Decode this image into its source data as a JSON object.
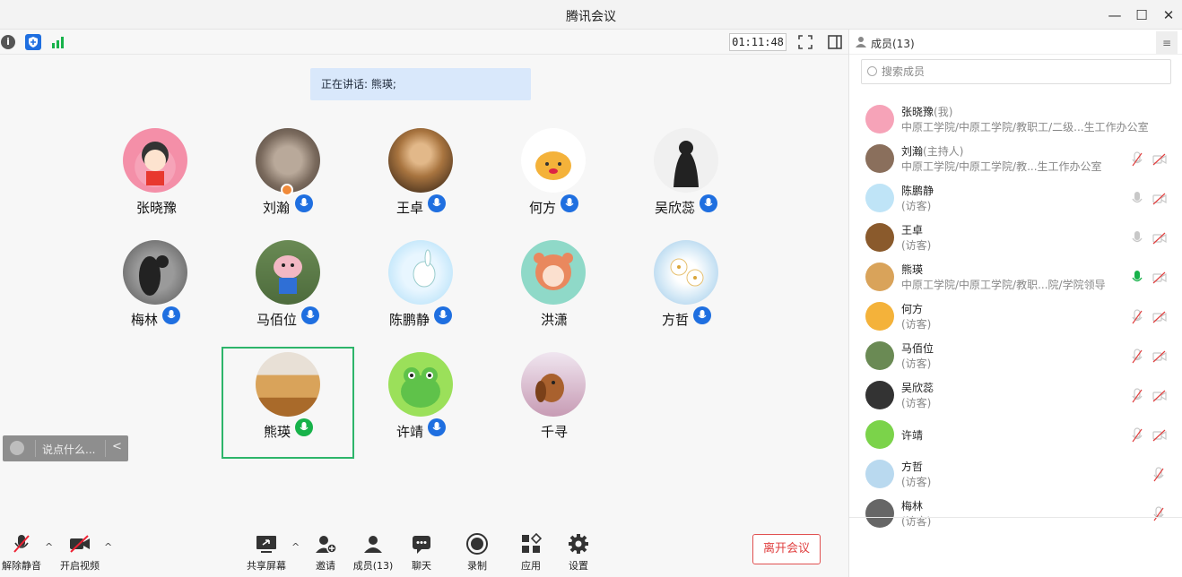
{
  "window": {
    "title": "腾讯会议"
  },
  "header": {
    "timer": "01:11:48"
  },
  "speaking": "正在讲话: 熊瑛;",
  "tiles": [
    {
      "name": "张晓豫",
      "mic": "none"
    },
    {
      "name": "刘瀚",
      "mic": "blue"
    },
    {
      "name": "王卓",
      "mic": "blue"
    },
    {
      "name": "何方",
      "mic": "blue"
    },
    {
      "name": "吴欣蕊",
      "mic": "blue"
    },
    {
      "name": "梅林",
      "mic": "blue"
    },
    {
      "name": "马佰位",
      "mic": "blue"
    },
    {
      "name": "陈鹏静",
      "mic": "blue"
    },
    {
      "name": "洪潇",
      "mic": "none"
    },
    {
      "name": "方哲",
      "mic": "blue"
    },
    {
      "name": "熊瑛",
      "mic": "green"
    },
    {
      "name": "许靖",
      "mic": "blue"
    },
    {
      "name": "千寻",
      "mic": "none"
    }
  ],
  "chat": {
    "placeholder": "说点什么..."
  },
  "toolbar": {
    "unmute": "解除静音",
    "video": "开启视频",
    "share": "共享屏幕",
    "invite": "邀请",
    "members": "成员(13)",
    "chat": "聊天",
    "record": "录制",
    "apps": "应用",
    "settings": "设置",
    "leave": "离开会议"
  },
  "panel": {
    "title": "成员(13)",
    "search_placeholder": "搜索成员",
    "members": [
      {
        "name": "张晓豫",
        "tag": "(我)",
        "sub": "中原工学院/中原工学院/教职工/二级...生工作办公室",
        "mic": "none",
        "cam": "none"
      },
      {
        "name": "刘瀚",
        "tag": "(主持人)",
        "sub": "中原工学院/中原工学院/教...生工作办公室",
        "mic": "muted",
        "cam": "off"
      },
      {
        "name": "陈鹏静",
        "tag": "",
        "sub": "(访客)",
        "mic": "idle",
        "cam": "off"
      },
      {
        "name": "王卓",
        "tag": "",
        "sub": "(访客)",
        "mic": "idle",
        "cam": "off"
      },
      {
        "name": "熊瑛",
        "tag": "",
        "sub": "中原工学院/中原工学院/教职...院/学院领导",
        "mic": "speaking",
        "cam": "off"
      },
      {
        "name": "何方",
        "tag": "",
        "sub": "(访客)",
        "mic": "muted",
        "cam": "off"
      },
      {
        "name": "马佰位",
        "tag": "",
        "sub": "(访客)",
        "mic": "muted",
        "cam": "off"
      },
      {
        "name": "吴欣蕊",
        "tag": "",
        "sub": "(访客)",
        "mic": "muted",
        "cam": "off"
      },
      {
        "name": "许靖",
        "tag": "",
        "sub": "",
        "mic": "muted",
        "cam": "off"
      },
      {
        "name": "方哲",
        "tag": "",
        "sub": "(访客)",
        "mic": "muted",
        "cam": "none"
      },
      {
        "name": "梅林",
        "tag": "",
        "sub": "(访客)",
        "mic": "muted",
        "cam": "none"
      }
    ]
  },
  "colors": {
    "accent": "#1f6fe0",
    "speaking": "#17b24a",
    "danger": "#e04040",
    "selected": "#2db56a"
  }
}
